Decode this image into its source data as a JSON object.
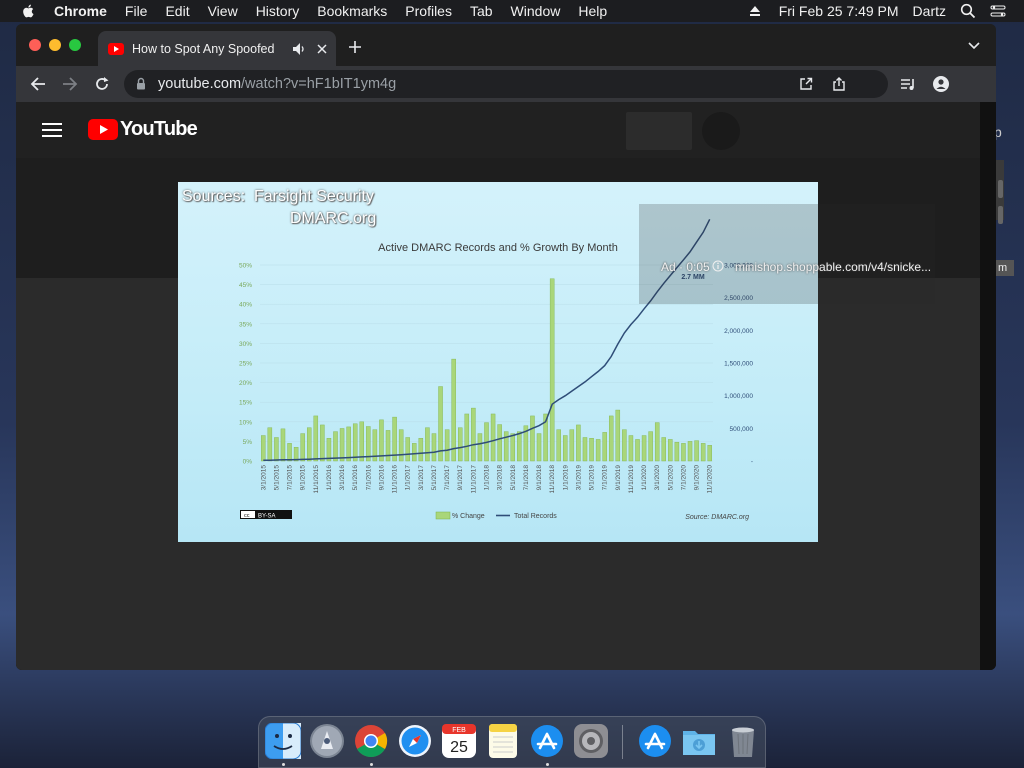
{
  "menubar": {
    "app": "Chrome",
    "items": [
      "File",
      "Edit",
      "View",
      "History",
      "Bookmarks",
      "Profiles",
      "Tab",
      "Window",
      "Help"
    ],
    "datetime": "Fri Feb 25  7:49 PM",
    "user": "Dartz"
  },
  "browser": {
    "tab_title": "How to Spot Any Spoofed",
    "url_host": "youtube.com",
    "url_path": "/watch?v=hF1bIT1ym4g"
  },
  "youtube": {
    "logo_text": "YouTube"
  },
  "video": {
    "sources_label": "Sources:",
    "source_1": "Farsight Security",
    "source_2": "DMARC.org",
    "ad_label": "Ad · 0:05",
    "ad_url": "minishop.shoppable.com/v4/snicke..."
  },
  "chart_data": {
    "type": "bar",
    "title": "Active DMARC Records and % Growth By Month",
    "series": [
      {
        "name": "% Change",
        "axis": "left",
        "color": "#a9d67a",
        "values": [
          6.5,
          8.5,
          6,
          8.2,
          4.5,
          3.5,
          7,
          8.5,
          11.5,
          9.2,
          5.8,
          7.5,
          8.3,
          8.7,
          9.5,
          10,
          8.8,
          8,
          10.5,
          7.8,
          11.2,
          8,
          6,
          4.5,
          5.8,
          8.5,
          7,
          19,
          8,
          26,
          8.5,
          12,
          13.5,
          7,
          9.8,
          12,
          9.3,
          7.5,
          7,
          7.5,
          9,
          11.5,
          7,
          12,
          46.5,
          8,
          6.5,
          8,
          9.2,
          6,
          5.8,
          5.5,
          7.3,
          11.5,
          13,
          8,
          6.5,
          5.5,
          6.5,
          7.5,
          9.8,
          6,
          5.5,
          4.8,
          4.5,
          5,
          5.2,
          4.5,
          4
        ]
      },
      {
        "name": "Total Records",
        "axis": "right",
        "color": "#2f4d78",
        "values": [
          10000,
          12000,
          15000,
          18000,
          20000,
          22000,
          25000,
          28000,
          32000,
          36000,
          40000,
          44000,
          48000,
          52000,
          57000,
          62000,
          67000,
          72000,
          78000,
          84000,
          90000,
          97000,
          104000,
          111000,
          118000,
          126000,
          135000,
          155000,
          165000,
          190000,
          205000,
          225000,
          250000,
          265000,
          285000,
          310000,
          340000,
          365000,
          390000,
          420000,
          455000,
          500000,
          540000,
          600000,
          870000,
          940000,
          1000000,
          1070000,
          1140000,
          1210000,
          1290000,
          1370000,
          1460000,
          1600000,
          1790000,
          1960000,
          2090000,
          2200000,
          2330000,
          2450000,
          2590000,
          2720000,
          2840000,
          2960000,
          3080000,
          3200000,
          3350000,
          3500000,
          3700000
        ]
      }
    ],
    "x_tick_labels": [
      "3/1/2015",
      "5/1/2015",
      "7/1/2015",
      "9/1/2015",
      "11/1/2015",
      "1/1/2016",
      "3/1/2016",
      "5/1/2016",
      "7/1/2016",
      "9/1/2016",
      "11/1/2016",
      "1/1/2017",
      "3/1/2017",
      "5/1/2017",
      "7/1/2017",
      "9/1/2017",
      "11/1/2017",
      "1/1/2018",
      "3/1/2018",
      "5/1/2018",
      "7/1/2018",
      "9/1/2018",
      "11/1/2018",
      "1/1/2019",
      "3/1/2019",
      "5/1/2019",
      "7/1/2019",
      "9/1/2019",
      "11/1/2019",
      "1/1/2020",
      "3/1/2020",
      "5/1/2020",
      "7/1/2020",
      "9/1/2020",
      "11/1/2020"
    ],
    "y_left_ticks": [
      "0%",
      "5%",
      "10%",
      "15%",
      "20%",
      "25%",
      "30%",
      "35%",
      "40%",
      "45%",
      "50%"
    ],
    "y_left_range": [
      0,
      50
    ],
    "y_right_ticks": [
      "-",
      "500,000",
      "1,000,000",
      "1,500,000",
      "2,000,000",
      "2,500,000",
      "3,000,000"
    ],
    "y_right_range": [
      0,
      3000000
    ],
    "annotation": "2.7 MM",
    "legend": [
      "% Change",
      "Total Records"
    ],
    "legend_position": "bottom",
    "source_note": "Source: DMARC.org",
    "license_badge": "BY-SA",
    "grid": true
  },
  "dock": {
    "apps": [
      "Finder",
      "Launchpad",
      "Google Chrome",
      "Safari",
      "Calendar",
      "Notes",
      "App Store",
      "System Preferences",
      "App Store",
      "Downloads",
      "Trash"
    ],
    "calendar_month": "FEB",
    "calendar_day": "25"
  },
  "colors": {
    "youtube_red": "#ff0000",
    "chart_bar": "#a9d67a",
    "chart_line": "#2f4d78"
  }
}
